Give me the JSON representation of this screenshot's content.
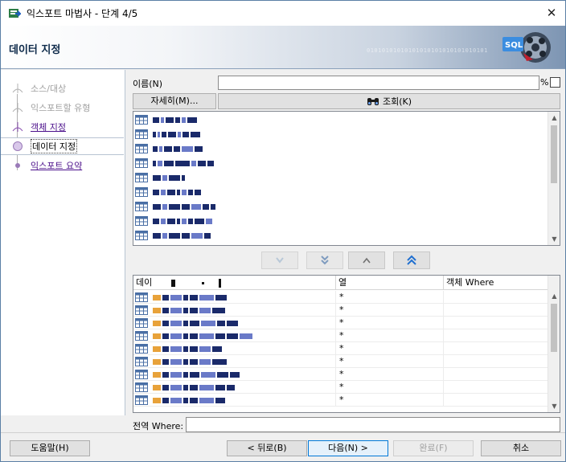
{
  "window": {
    "title": "익스포트 마법사 - 단계 4/5",
    "close_glyph": "✕"
  },
  "header": {
    "title": "데이터 지정",
    "binary_text": "01010101010101010101010101010101",
    "graphic_text": "SQL"
  },
  "nav": {
    "items": [
      {
        "label": "소스/대상",
        "state": "done"
      },
      {
        "label": "익스포트할 유형",
        "state": "done"
      },
      {
        "label": "객체 지정",
        "state": "link"
      },
      {
        "label": "데이터 지정",
        "state": "active"
      },
      {
        "label": "익스포트 요약",
        "state": "link"
      }
    ]
  },
  "filter": {
    "name_label": "이름(N)",
    "name_value": "",
    "percent_label": "%",
    "detail_button": "자세히(M)...",
    "lookup_button": "조회(K)"
  },
  "available_list": {
    "rows": 9
  },
  "move_buttons": {
    "down_one": "move-down",
    "down_all": "move-all-down",
    "up_one": "move-up",
    "up_all": "move-all-up"
  },
  "selected_table": {
    "columns": [
      "데이",
      "열",
      "객체 Where"
    ],
    "rows": [
      {
        "col": "*"
      },
      {
        "col": "*"
      },
      {
        "col": "*"
      },
      {
        "col": "*"
      },
      {
        "col": "*"
      },
      {
        "col": "*"
      },
      {
        "col": "*"
      },
      {
        "col": "*"
      },
      {
        "col": "*"
      }
    ]
  },
  "global_where": {
    "label": "전역 Where:",
    "value": ""
  },
  "footer": {
    "help": "도움말(H)",
    "back": "< 뒤로(B)",
    "next": "다음(N) >",
    "finish": "완료(F)",
    "cancel": "취소"
  },
  "colors": {
    "accent": "#0078d7",
    "link": "#4a0e8a",
    "header_dark": "#7d95b3",
    "redact_dark": "#1a2a6a",
    "redact_orange": "#e8a23a",
    "table_icon": "#4a6fa5"
  }
}
